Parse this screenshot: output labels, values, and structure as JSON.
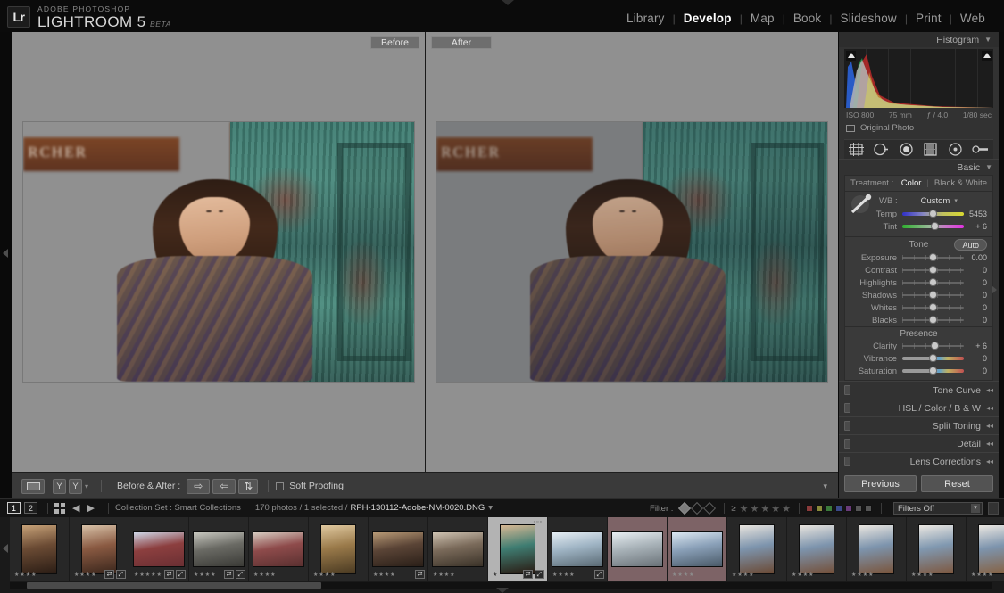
{
  "app": {
    "logo_text": "Lr",
    "brand_sub": "ADOBE PHOTOSHOP",
    "brand_main": "LIGHTROOM 5",
    "brand_beta": "BETA"
  },
  "modules": [
    {
      "label": "Library",
      "active": false
    },
    {
      "label": "Develop",
      "active": true
    },
    {
      "label": "Map",
      "active": false
    },
    {
      "label": "Book",
      "active": false
    },
    {
      "label": "Slideshow",
      "active": false
    },
    {
      "label": "Print",
      "active": false
    },
    {
      "label": "Web",
      "active": false
    }
  ],
  "view": {
    "before_label": "Before",
    "after_label": "After",
    "photo_sign_text": "RCHER",
    "backdrop_color": "#909090"
  },
  "toolbar": {
    "loupe_icon": "loupe-view-icon",
    "yy_label_a": "Y",
    "yy_label_b": "Y",
    "caret": "▾",
    "before_after_label": "Before & After :",
    "copy_after_to_before": "⇨",
    "copy_before_to_after": "⇦",
    "swap_before_after": "⇅",
    "soft_proofing_label": "Soft Proofing",
    "right_caret": "▾"
  },
  "histogram": {
    "title": "Histogram",
    "twisty": "▼",
    "iso": "ISO 800",
    "focal": "75 mm",
    "aperture": "ƒ / 4.0",
    "shutter": "1/80 sec",
    "original_photo": "Original Photo"
  },
  "tools": [
    {
      "name": "crop-overlay-icon"
    },
    {
      "name": "spot-removal-icon"
    },
    {
      "name": "red-eye-correction-icon"
    },
    {
      "name": "graduated-filter-icon"
    },
    {
      "name": "radial-filter-icon"
    },
    {
      "name": "adjustment-brush-icon"
    }
  ],
  "basic": {
    "title": "Basic",
    "twisty": "▼",
    "treatment_label": "Treatment :",
    "treatment_color": "Color",
    "treatment_bw": "Black & White",
    "wb_label": "WB :",
    "wb_value": "Custom",
    "tone_label": "Tone",
    "auto_label": "Auto",
    "presence_label": "Presence",
    "sliders": [
      {
        "label": "Temp",
        "value": "5453",
        "pos": 50,
        "grad": "temp"
      },
      {
        "label": "Tint",
        "value": "+ 6",
        "pos": 53,
        "grad": "tint"
      },
      {
        "label": "Exposure",
        "value": "0.00",
        "pos": 50,
        "grad": ""
      },
      {
        "label": "Contrast",
        "value": "0",
        "pos": 50,
        "grad": ""
      },
      {
        "label": "Highlights",
        "value": "0",
        "pos": 50,
        "grad": ""
      },
      {
        "label": "Shadows",
        "value": "0",
        "pos": 50,
        "grad": ""
      },
      {
        "label": "Whites",
        "value": "0",
        "pos": 50,
        "grad": ""
      },
      {
        "label": "Blacks",
        "value": "0",
        "pos": 50,
        "grad": ""
      },
      {
        "label": "Clarity",
        "value": "+ 6",
        "pos": 53,
        "grad": ""
      },
      {
        "label": "Vibrance",
        "value": "0",
        "pos": 50,
        "grad": "vib"
      },
      {
        "label": "Saturation",
        "value": "0",
        "pos": 50,
        "grad": "vib"
      }
    ]
  },
  "collapsed_panels": [
    {
      "label": "Tone Curve"
    },
    {
      "label": "HSL / Color / B & W"
    },
    {
      "label": "Split Toning"
    },
    {
      "label": "Detail"
    },
    {
      "label": "Lens Corrections"
    }
  ],
  "actions": {
    "previous": "Previous",
    "reset": "Reset"
  },
  "filmstrip_bar": {
    "page_1": "1",
    "page_2": "2",
    "back_arrow": "◀",
    "forward_arrow": "▶",
    "source": "Collection Set : Smart Collections",
    "count": "170 photos / 1 selected /",
    "filename": "RPH-130112-Adobe-NM-0020.DNG",
    "filename_caret": "▾",
    "filter_label": "Filter :",
    "rating_op": "≥",
    "star": "★",
    "filters_off": "Filters Off",
    "filter_caret": "▾",
    "color_labels": [
      "#8a3b3b",
      "#8a8a3b",
      "#3b7a3b",
      "#3b4a8a",
      "#6a3b7a",
      "#555555",
      "#555555"
    ]
  },
  "thumbnails": [
    {
      "name": "shop-interior",
      "stars": "★★★★",
      "badges": [],
      "orient": "portrait",
      "selected": false,
      "label": false,
      "c1": "#6b4b34",
      "c2": "#2b1d15",
      "c3": "#c7a278"
    },
    {
      "name": "horse-handler",
      "stars": "★★★★",
      "badges": [
        "⇄",
        "⤢"
      ],
      "orient": "portrait",
      "selected": false,
      "label": false,
      "c1": "#8a5a42",
      "c2": "#3a261c",
      "c3": "#d8c2a8"
    },
    {
      "name": "barn-beam-sun",
      "stars": "★★★★★",
      "badges": [
        "⇄",
        "⤢"
      ],
      "orient": "landscape",
      "selected": false,
      "label": false,
      "c1": "#8c3f3f",
      "c2": "#6a2f33",
      "c3": "#cfd8e8"
    },
    {
      "name": "cattle-drive",
      "stars": "★★★★",
      "badges": [
        "⇄",
        "⤢"
      ],
      "orient": "landscape",
      "selected": false,
      "label": false,
      "c1": "#6a6a64",
      "c2": "#3a3a36",
      "c3": "#c8c8c0"
    },
    {
      "name": "ranch-crew",
      "stars": "★★★★",
      "badges": [],
      "orient": "landscape",
      "selected": false,
      "label": false,
      "c1": "#8e4b4b",
      "c2": "#5a3030",
      "c3": "#d8cdc2"
    },
    {
      "name": "wood-wall-portrait",
      "stars": "★★★★",
      "badges": [],
      "orient": "portrait",
      "selected": false,
      "label": false,
      "c1": "#9a7a4a",
      "c2": "#4a3a22",
      "c3": "#e0c9a0"
    },
    {
      "name": "barn-interior",
      "stars": "★★★★",
      "badges": [
        "⇄"
      ],
      "orient": "landscape",
      "selected": false,
      "label": false,
      "c1": "#5a4436",
      "c2": "#2a1f18",
      "c3": "#b89a76"
    },
    {
      "name": "group-portrait",
      "stars": "★★★★",
      "badges": [],
      "orient": "landscape",
      "selected": false,
      "label": false,
      "c1": "#7a6a5a",
      "c2": "#3a3228",
      "c3": "#cfc3b2"
    },
    {
      "name": "woman-green-door",
      "stars": "★",
      "badges": [
        "⇄",
        "⤢"
      ],
      "orient": "portrait",
      "selected": true,
      "label": false,
      "c1": "#3f7d72",
      "c2": "#2a1a12",
      "c3": "#d8b894"
    },
    {
      "name": "snow-aspens-up",
      "stars": "★★★★",
      "badges": [
        "⤢"
      ],
      "orient": "landscape",
      "selected": false,
      "label": false,
      "c1": "#9fb4c4",
      "c2": "#5a6a74",
      "c3": "#e6eef4"
    },
    {
      "name": "snow-aspens",
      "stars": "",
      "badges": [],
      "orient": "landscape",
      "selected": false,
      "label": true,
      "c1": "#a8b2b8",
      "c2": "#6a7278",
      "c3": "#e8eef2"
    },
    {
      "name": "winter-group",
      "stars": "★★★★",
      "badges": [],
      "orient": "landscape",
      "selected": false,
      "label": true,
      "c1": "#8aa0b8",
      "c2": "#4a5a68",
      "c3": "#dce8f2"
    },
    {
      "name": "canyon-snow-1",
      "stars": "★★★★",
      "badges": [],
      "orient": "portrait",
      "selected": false,
      "label": false,
      "c1": "#7d94ad",
      "c2": "#6b4a35",
      "c3": "#e8e4de"
    },
    {
      "name": "canyon-snow-2",
      "stars": "★★★★",
      "badges": [],
      "orient": "portrait",
      "selected": false,
      "label": false,
      "c1": "#7d94ad",
      "c2": "#74503a",
      "c3": "#e8e4de"
    },
    {
      "name": "canyon-snow-3",
      "stars": "★★★★",
      "badges": [],
      "orient": "portrait",
      "selected": false,
      "label": false,
      "c1": "#7d94ad",
      "c2": "#7a553c",
      "c3": "#eae6e0"
    },
    {
      "name": "canyon-snow-4",
      "stars": "★★★★",
      "badges": [],
      "orient": "portrait",
      "selected": false,
      "label": false,
      "c1": "#8098b0",
      "c2": "#7d5840",
      "c3": "#ece8e2"
    },
    {
      "name": "canyon-snow-5",
      "stars": "★★★★",
      "badges": [],
      "orient": "portrait",
      "selected": false,
      "label": false,
      "c1": "#7d94ad",
      "c2": "#86603f",
      "c3": "#ece8e2"
    }
  ]
}
